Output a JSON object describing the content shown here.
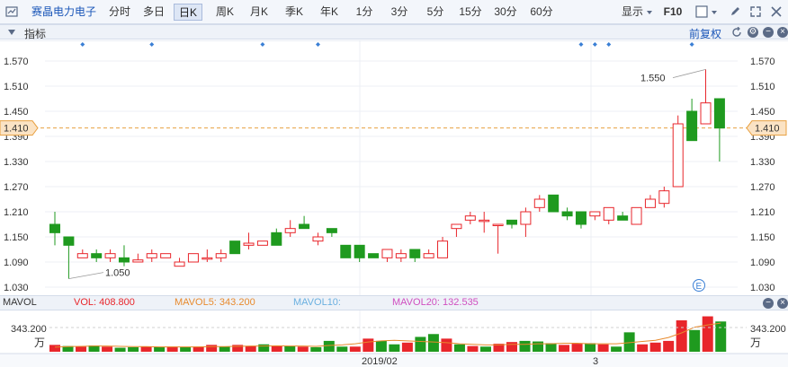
{
  "toolbar": {
    "stock_name": "赛晶电力电子",
    "periods": [
      "分时",
      "多日",
      "日K",
      "周K",
      "月K",
      "季K",
      "年K",
      "1分",
      "3分",
      "5分",
      "15分",
      "30分",
      "60分"
    ],
    "active_period": "日K",
    "display_label": "显示",
    "f10_label": "F10"
  },
  "indicator_bar": {
    "label": "指标",
    "adjust_label": "前复权"
  },
  "main_chart": {
    "y_ticks": [
      "1.570",
      "1.510",
      "1.450",
      "1.390",
      "1.330",
      "1.270",
      "1.210",
      "1.150",
      "1.090",
      "1.030"
    ],
    "current_price_label": "1.410",
    "high_label": "1.550",
    "low_label": "1.050",
    "e_marker": "E"
  },
  "volume_bar": {
    "label": "MAVOL",
    "vol": "VOL: 408.800",
    "ma5": "MAVOL5: 343.200",
    "ma10": "MAVOL10:",
    "ma20": "MAVOL20: 132.535"
  },
  "volume_chart": {
    "level_label": "343.200",
    "unit_label": "万"
  },
  "x_labels": [
    "2019/02",
    "3"
  ],
  "colors": {
    "up": "#e8262b",
    "down": "#1f9a1f",
    "ma5": "#e88a2d",
    "ma10": "#6ab0e0",
    "ma20": "#d04fc0",
    "price_line": "#e8a040"
  },
  "chart_data": {
    "type": "candlestick",
    "y_axis_range": [
      1.03,
      1.57
    ],
    "candles": [
      {
        "open": 1.18,
        "close": 1.16,
        "high": 1.21,
        "low": 1.13
      },
      {
        "open": 1.15,
        "close": 1.13,
        "high": 1.15,
        "low": 1.05
      },
      {
        "open": 1.1,
        "close": 1.11,
        "high": 1.12,
        "low": 1.1
      },
      {
        "open": 1.11,
        "close": 1.1,
        "high": 1.12,
        "low": 1.09
      },
      {
        "open": 1.1,
        "close": 1.11,
        "high": 1.12,
        "low": 1.09
      },
      {
        "open": 1.1,
        "close": 1.09,
        "high": 1.13,
        "low": 1.08
      },
      {
        "open": 1.09,
        "close": 1.095,
        "high": 1.11,
        "low": 1.09
      },
      {
        "open": 1.1,
        "close": 1.11,
        "high": 1.12,
        "low": 1.09
      },
      {
        "open": 1.1,
        "close": 1.11,
        "high": 1.11,
        "low": 1.1
      },
      {
        "open": 1.08,
        "close": 1.09,
        "high": 1.1,
        "low": 1.08
      },
      {
        "open": 1.09,
        "close": 1.11,
        "high": 1.11,
        "low": 1.09
      },
      {
        "open": 1.1,
        "close": 1.1,
        "high": 1.12,
        "low": 1.09
      },
      {
        "open": 1.1,
        "close": 1.11,
        "high": 1.12,
        "low": 1.09
      },
      {
        "open": 1.14,
        "close": 1.11,
        "high": 1.14,
        "low": 1.11
      },
      {
        "open": 1.13,
        "close": 1.135,
        "high": 1.16,
        "low": 1.12
      },
      {
        "open": 1.13,
        "close": 1.14,
        "high": 1.14,
        "low": 1.13
      },
      {
        "open": 1.16,
        "close": 1.13,
        "high": 1.17,
        "low": 1.13
      },
      {
        "open": 1.16,
        "close": 1.17,
        "high": 1.19,
        "low": 1.15
      },
      {
        "open": 1.18,
        "close": 1.17,
        "high": 1.2,
        "low": 1.17
      },
      {
        "open": 1.14,
        "close": 1.15,
        "high": 1.16,
        "low": 1.13
      },
      {
        "open": 1.17,
        "close": 1.16,
        "high": 1.17,
        "low": 1.15
      },
      {
        "open": 1.13,
        "close": 1.1,
        "high": 1.13,
        "low": 1.1
      },
      {
        "open": 1.13,
        "close": 1.1,
        "high": 1.13,
        "low": 1.09
      },
      {
        "open": 1.11,
        "close": 1.1,
        "high": 1.11,
        "low": 1.1
      },
      {
        "open": 1.1,
        "close": 1.12,
        "high": 1.12,
        "low": 1.09
      },
      {
        "open": 1.1,
        "close": 1.11,
        "high": 1.12,
        "low": 1.09
      },
      {
        "open": 1.12,
        "close": 1.1,
        "high": 1.12,
        "low": 1.09
      },
      {
        "open": 1.1,
        "close": 1.11,
        "high": 1.12,
        "low": 1.1
      },
      {
        "open": 1.1,
        "close": 1.14,
        "high": 1.15,
        "low": 1.1
      },
      {
        "open": 1.17,
        "close": 1.18,
        "high": 1.18,
        "low": 1.15
      },
      {
        "open": 1.19,
        "close": 1.2,
        "high": 1.21,
        "low": 1.18
      },
      {
        "open": 1.19,
        "close": 1.19,
        "high": 1.21,
        "low": 1.16
      },
      {
        "open": 1.18,
        "close": 1.18,
        "high": 1.18,
        "low": 1.11
      },
      {
        "open": 1.19,
        "close": 1.18,
        "high": 1.19,
        "low": 1.17
      },
      {
        "open": 1.18,
        "close": 1.21,
        "high": 1.22,
        "low": 1.15
      },
      {
        "open": 1.22,
        "close": 1.24,
        "high": 1.25,
        "low": 1.21
      },
      {
        "open": 1.25,
        "close": 1.21,
        "high": 1.25,
        "low": 1.21
      },
      {
        "open": 1.21,
        "close": 1.2,
        "high": 1.22,
        "low": 1.19
      },
      {
        "open": 1.21,
        "close": 1.18,
        "high": 1.21,
        "low": 1.17
      },
      {
        "open": 1.2,
        "close": 1.21,
        "high": 1.21,
        "low": 1.19
      },
      {
        "open": 1.19,
        "close": 1.22,
        "high": 1.22,
        "low": 1.18
      },
      {
        "open": 1.2,
        "close": 1.19,
        "high": 1.21,
        "low": 1.19
      },
      {
        "open": 1.18,
        "close": 1.22,
        "high": 1.22,
        "low": 1.18
      },
      {
        "open": 1.22,
        "close": 1.24,
        "high": 1.25,
        "low": 1.22
      },
      {
        "open": 1.23,
        "close": 1.26,
        "high": 1.27,
        "low": 1.22
      },
      {
        "open": 1.27,
        "close": 1.42,
        "high": 1.44,
        "low": 1.27
      },
      {
        "open": 1.45,
        "close": 1.38,
        "high": 1.48,
        "low": 1.38
      },
      {
        "open": 1.42,
        "close": 1.47,
        "high": 1.55,
        "low": 1.42
      },
      {
        "open": 1.48,
        "close": 1.41,
        "high": 1.48,
        "low": 1.33
      }
    ],
    "volumes": [
      1.2,
      1.0,
      0.9,
      1.1,
      0.9,
      0.7,
      0.8,
      0.9,
      0.8,
      0.9,
      0.8,
      0.9,
      1.2,
      0.9,
      1.2,
      1.0,
      1.3,
      1.1,
      1.0,
      0.9,
      0.8,
      1.9,
      0.9,
      0.9,
      2.3,
      1.9,
      1.3,
      1.6,
      2.6,
      3.1,
      2.3,
      1.3,
      1.0,
      0.9,
      1.4,
      1.7,
      1.9,
      1.8,
      1.5,
      1.2,
      1.4,
      1.5,
      1.3,
      0.9,
      3.4,
      1.3,
      1.6,
      1.9,
      5.5,
      3.8,
      6.2,
      5.3
    ],
    "volume_colors": [
      "up",
      "down",
      "up",
      "down",
      "up",
      "down",
      "down",
      "up",
      "down",
      "up",
      "down",
      "up",
      "up",
      "down",
      "up",
      "up",
      "down",
      "up",
      "down",
      "up",
      "down",
      "down",
      "down",
      "up",
      "up",
      "down",
      "down",
      "up",
      "down",
      "down",
      "up",
      "down",
      "up",
      "down",
      "up",
      "up",
      "down",
      "down",
      "down",
      "up",
      "up",
      "down",
      "up",
      "down",
      "down",
      "up",
      "up",
      "up",
      "up",
      "down",
      "up",
      "down"
    ],
    "ma_line": [
      0.8,
      0.9,
      0.95,
      1.0,
      1.0,
      0.95,
      0.9,
      0.9,
      0.85,
      0.85,
      0.85,
      0.85,
      0.9,
      0.9,
      0.95,
      1.0,
      1.0,
      1.05,
      1.0,
      1.0,
      0.95,
      1.1,
      1.2,
      1.4,
      1.7,
      1.9,
      2.0,
      1.9,
      1.8,
      1.7,
      1.6,
      1.4,
      1.3,
      1.2,
      1.2,
      1.3,
      1.3,
      1.4,
      1.4,
      1.5,
      1.5,
      1.4,
      1.4,
      1.4,
      1.6,
      1.8,
      2.0,
      2.5,
      3.3,
      4.3,
      4.7,
      5.0
    ],
    "markers": [
      2,
      7,
      15,
      19,
      38,
      39,
      40,
      46
    ]
  }
}
